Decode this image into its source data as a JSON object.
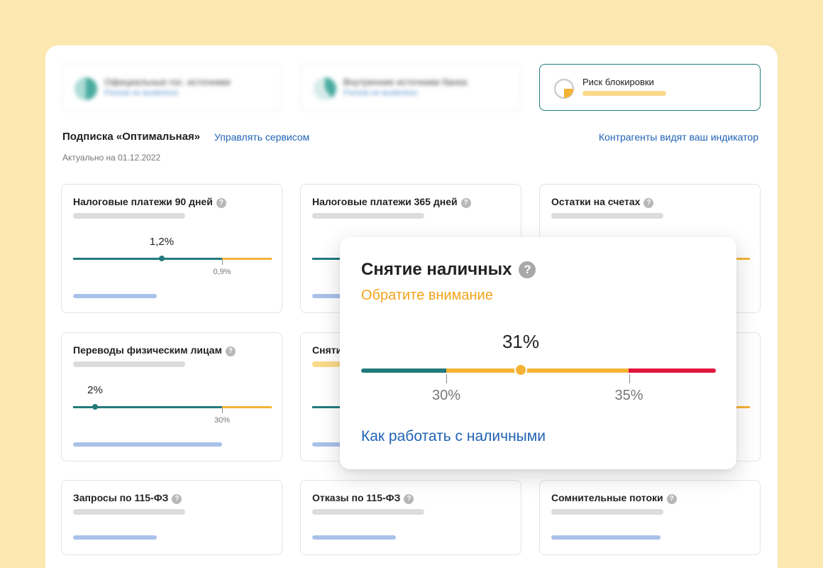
{
  "colors": {
    "background": "#fbe8b1",
    "teal": "#237a7d",
    "orange": "#f5b335",
    "red": "#e0163c",
    "link": "#1f63b5",
    "warning_text": "#f2a31c",
    "placeholder_gray": "#dcdcdc",
    "placeholder_blue": "#a9c2ea"
  },
  "status_tiles": [
    {
      "title": "Официальные гос. источники",
      "subtitle": "Рисков не выявлено",
      "icon": "teal-ring-icon"
    },
    {
      "title": "Внутренние источники банка",
      "subtitle": "Рисков не выявлено",
      "icon": "teal-ring-icon"
    },
    {
      "title": "Риск блокировки",
      "progress": 0.35,
      "icon": "risk-ring-icon"
    }
  ],
  "subscription": {
    "title": "Подписка «Оптимальная»",
    "manage_link": "Управлять сервисом",
    "partners_link": "Контрагенты видят ваш индикатор",
    "actual_label": "Актуально на  01.12.2022"
  },
  "cards": [
    {
      "title": "Налоговые платежи 90 дней",
      "value": "1,2%",
      "value_pos": 0.45,
      "threshold_label": "0,9%",
      "threshold_pos": 0.75
    },
    {
      "title": "Налоговые платежи 365 дней"
    },
    {
      "title": "Остатки на счетах"
    },
    {
      "title": "Переводы физическим лицам",
      "value": "2%",
      "value_pos": 0.11,
      "threshold_label": "30%",
      "threshold_pos": 0.75
    },
    {
      "title": "Сняти"
    },
    {
      "title": ""
    },
    {
      "title": "Запросы по 115-ФЗ"
    },
    {
      "title": "Отказы по 115-ФЗ"
    },
    {
      "title": "Сомнительные потоки"
    }
  ],
  "popup": {
    "title": "Снятие наличных",
    "status": "Обратите внимание",
    "value": "31%",
    "value_pos": 0.45,
    "thresholds": [
      {
        "label": "30%",
        "pos": 0.24
      },
      {
        "label": "35%",
        "pos": 0.755
      }
    ],
    "link": "Как работать с наличными"
  }
}
